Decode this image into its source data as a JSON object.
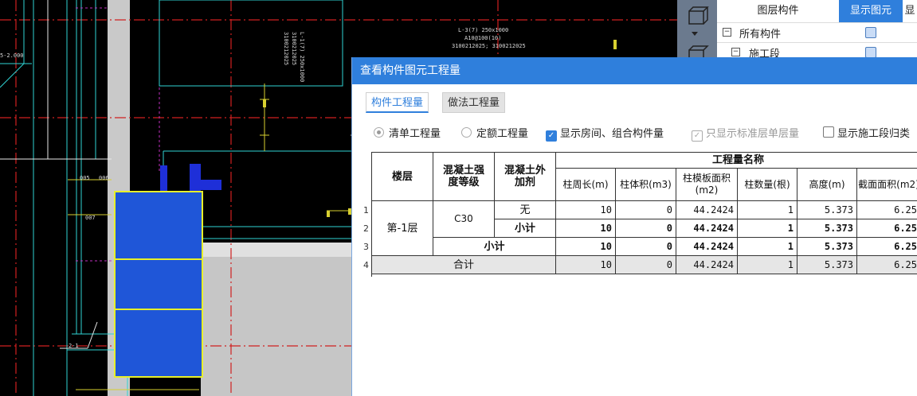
{
  "cad": {
    "labels": {
      "elev": "5-2.000",
      "note1": "L-3(7) 250x1000",
      "note2": "A10@100(10)",
      "note3": "3100212025; 3100212025",
      "vert1": "3100212025",
      "vert2": "3100212025",
      "vert3": "L-1(7) 250x1000",
      "tag1": "2-1",
      "tag2": "005",
      "tag3": "006",
      "tag4": "007"
    }
  },
  "layer_panel": {
    "headers": [
      "图层构件",
      "显示图元",
      "显"
    ],
    "rows": [
      {
        "label": "所有构件",
        "expander": "−"
      },
      {
        "label": "施工段",
        "expander": "−"
      }
    ]
  },
  "dialog": {
    "title": "查看构件图元工程量",
    "tabs": [
      {
        "label": "构件工程量",
        "active": true
      },
      {
        "label": "做法工程量",
        "active": false
      }
    ],
    "options": [
      {
        "label": "清单工程量",
        "type": "radio",
        "checked": true,
        "disabled": true
      },
      {
        "label": "定额工程量",
        "type": "radio",
        "checked": false,
        "disabled": true
      },
      {
        "label": "显示房间、组合构件量",
        "type": "checkbox",
        "checked": true,
        "disabled": false
      },
      {
        "label": "只显示标准层单层量",
        "type": "checkbox",
        "checked": true,
        "disabled": true
      },
      {
        "label": "显示施工段归类",
        "type": "checkbox",
        "checked": false,
        "disabled": false
      }
    ],
    "table": {
      "group_header": "工程量名称",
      "headers": {
        "floor": "楼层",
        "grade": "混凝土强度等级",
        "additive": "混凝土外加剂",
        "perimeter": "柱周长(m)",
        "volume": "柱体积(m3)",
        "formwork": "柱模板面积(m2)",
        "count": "柱数量(根)",
        "height": "高度(m)",
        "section": "截面面积(m2)"
      },
      "row_numbers": [
        "1",
        "2",
        "3",
        "4"
      ],
      "floor_value": "第-1层",
      "grade_value": "C30",
      "rows": [
        {
          "additive": "无",
          "perimeter": "10",
          "volume": "0",
          "formwork": "44.2424",
          "count": "1",
          "height": "5.373",
          "section": "6.25"
        },
        {
          "additive": "小计",
          "perimeter": "10",
          "volume": "0",
          "formwork": "44.2424",
          "count": "1",
          "height": "5.373",
          "section": "6.25"
        },
        {
          "label": "小计",
          "perimeter": "10",
          "volume": "0",
          "formwork": "44.2424",
          "count": "1",
          "height": "5.373",
          "section": "6.25"
        },
        {
          "label": "合计",
          "perimeter": "10",
          "volume": "0",
          "formwork": "44.2424",
          "count": "1",
          "height": "5.373",
          "section": "6.25"
        }
      ]
    }
  }
}
